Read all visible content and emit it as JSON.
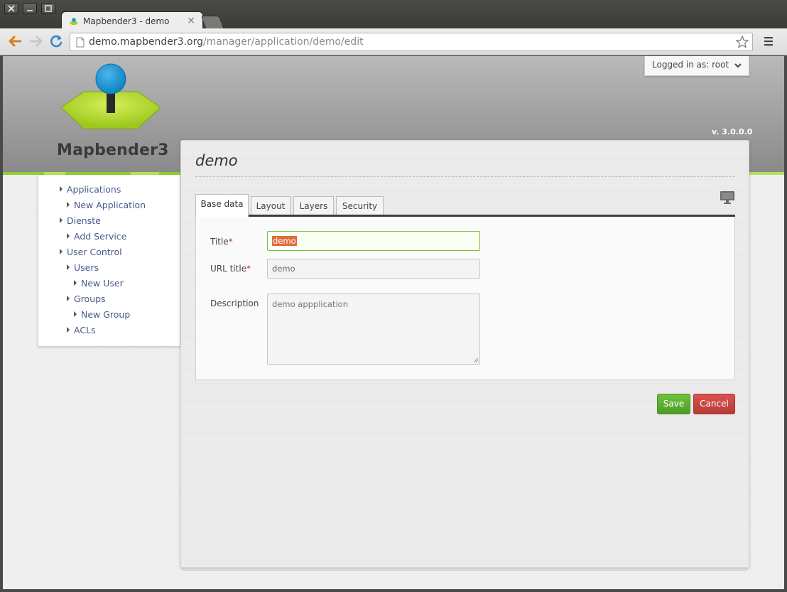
{
  "browser": {
    "tab_title": "Mapbender3 - demo",
    "tab_close": "×",
    "url_host": "demo.mapbender3.org",
    "url_path": "/manager/application/demo/edit"
  },
  "header": {
    "logo_text": "Mapbender3",
    "version": "v. 3.0.0.0",
    "login_text": "Logged in as: root"
  },
  "sidebar": {
    "items": [
      {
        "label": "Applications"
      },
      {
        "label": "New Application"
      },
      {
        "label": "Dienste"
      },
      {
        "label": "Add Service"
      },
      {
        "label": "User Control"
      },
      {
        "label": "Users"
      },
      {
        "label": "New User"
      },
      {
        "label": "Groups"
      },
      {
        "label": "New Group"
      },
      {
        "label": "ACLs"
      }
    ]
  },
  "main": {
    "page_title": "demo",
    "tabs": [
      {
        "label": "Base data"
      },
      {
        "label": "Layout"
      },
      {
        "label": "Layers"
      },
      {
        "label": "Security"
      }
    ],
    "form": {
      "title_label": "Title",
      "title_value": "demo",
      "url_title_label": "URL title",
      "url_title_value": "demo",
      "description_label": "Description",
      "description_value": "demo appplication",
      "required_mark": "*"
    },
    "save_label": "Save",
    "cancel_label": "Cancel"
  },
  "colors": {
    "accent_green": "#8fce2f",
    "save_button": "#5cb531",
    "cancel_button": "#c9443f"
  }
}
